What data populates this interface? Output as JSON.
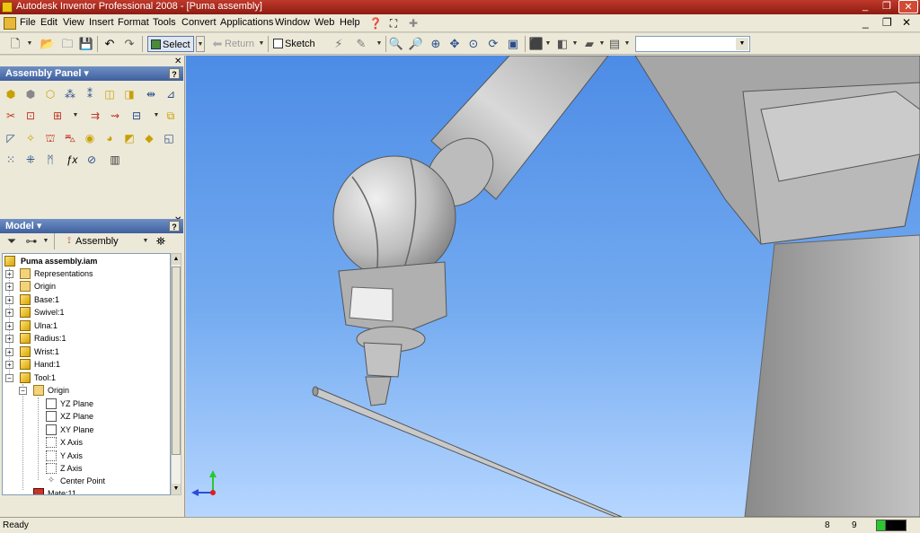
{
  "window": {
    "title": "Autodesk Inventor Professional 2008 - [Puma assembly]",
    "min_glyph": "_",
    "max_glyph": "❐",
    "close_glyph": "✕"
  },
  "menu": {
    "items": [
      "File",
      "Edit",
      "View",
      "Insert",
      "Format",
      "Tools",
      "Convert",
      "Applications",
      "Window",
      "Web",
      "Help"
    ]
  },
  "toolbar": {
    "select_label": "Select",
    "return_label": "Return",
    "sketch_label": "Sketch",
    "style_value": ""
  },
  "assembly_panel": {
    "title": "Assembly Panel ▾",
    "help": "?"
  },
  "model_panel": {
    "title": "Model ▾",
    "help": "?",
    "view_label": "Assembly View"
  },
  "tree": {
    "root": "Puma assembly.iam",
    "items": [
      {
        "label": "Representations",
        "icon": "representations-icon"
      },
      {
        "label": "Origin",
        "icon": "folder-icon"
      },
      {
        "label": "Base:1",
        "icon": "grounded-part-icon"
      },
      {
        "label": "Swivel:1",
        "icon": "part-icon"
      },
      {
        "label": "Ulna:1",
        "icon": "part-icon"
      },
      {
        "label": "Radius:1",
        "icon": "part-icon"
      },
      {
        "label": "Wrist:1",
        "icon": "part-icon"
      },
      {
        "label": "Hand:1",
        "icon": "part-icon"
      },
      {
        "label": "Tool:1",
        "icon": "part-icon"
      }
    ],
    "tool_children": {
      "origin": "Origin",
      "items": [
        "YZ Plane",
        "XZ Plane",
        "XY Plane",
        "X Axis",
        "Y Axis",
        "Z Axis",
        "Center Point"
      ]
    },
    "mate": "Mate:11"
  },
  "status": {
    "ready": "Ready",
    "num1": "8",
    "num2": "9"
  },
  "colors": {
    "title_bar": "#a93226",
    "viewport_top": "#4d8ce6",
    "viewport_bottom": "#b6d6ff",
    "model_grey": "#b8b8b8"
  }
}
